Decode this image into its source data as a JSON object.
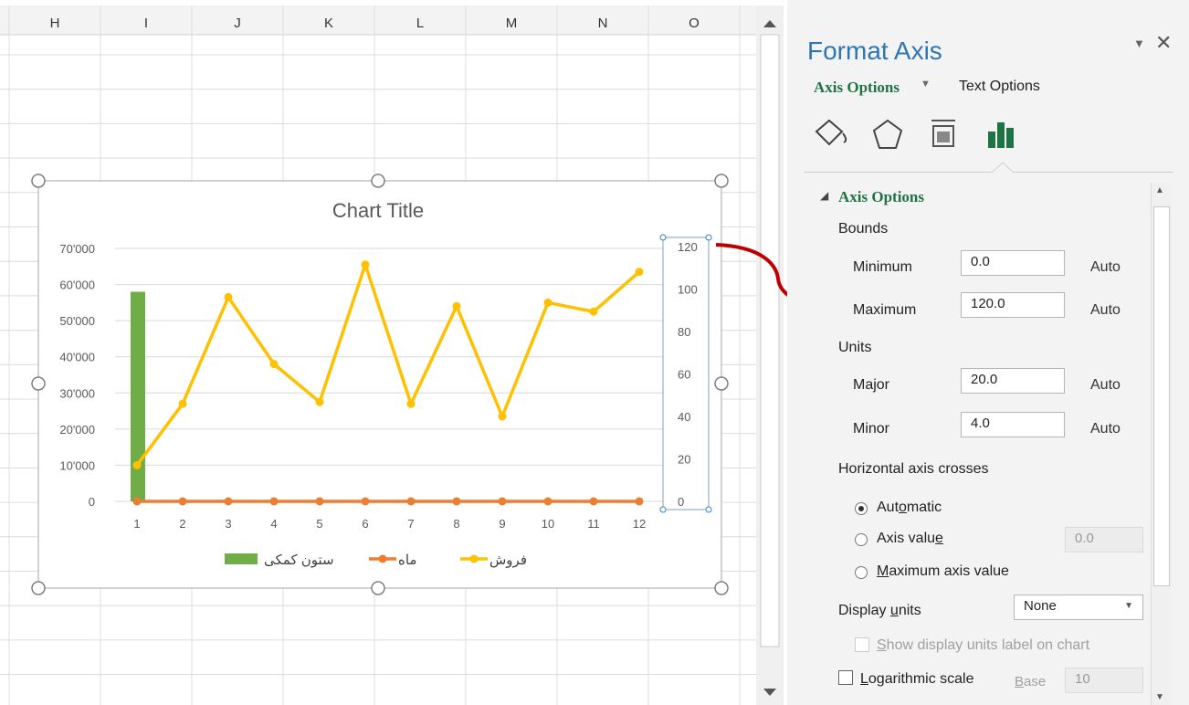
{
  "sheet": {
    "columns": [
      "H",
      "I",
      "J",
      "K",
      "L",
      "M",
      "N",
      "O"
    ]
  },
  "chart": {
    "title": "Chart Title"
  },
  "chart_data": {
    "type": "line",
    "title": "Chart Title",
    "x": [
      1,
      2,
      3,
      4,
      5,
      6,
      7,
      8,
      9,
      10,
      11,
      12
    ],
    "y_axis_left": {
      "ticks": [
        "0",
        "10'000",
        "20'000",
        "30'000",
        "40'000",
        "50'000",
        "60'000",
        "70'000"
      ],
      "range": [
        0,
        70000
      ]
    },
    "y_axis_right": {
      "ticks": [
        "0",
        "20",
        "40",
        "60",
        "80",
        "100",
        "120"
      ],
      "range": [
        0,
        120
      ]
    },
    "series": [
      {
        "name": "ستون کمکی",
        "type": "bar",
        "axis": "left",
        "color": "#70ad47",
        "values": [
          58000,
          0,
          0,
          0,
          0,
          0,
          0,
          0,
          0,
          0,
          0,
          0
        ]
      },
      {
        "name": "ماه",
        "type": "line",
        "axis": "left",
        "color": "#ed7d31",
        "values": [
          0,
          0,
          0,
          0,
          0,
          0,
          0,
          0,
          0,
          0,
          0,
          0
        ]
      },
      {
        "name": "فروش",
        "type": "line",
        "axis": "left",
        "color": "#ffc000",
        "values": [
          10000,
          27000,
          56500,
          38000,
          27500,
          65500,
          27000,
          54000,
          23500,
          55000,
          52500,
          63500
        ]
      }
    ],
    "legend": [
      "ستون کمکی",
      "ماه",
      "فروش"
    ],
    "legend_position": "bottom"
  },
  "panel": {
    "title": "Format Axis",
    "tab_axis_options": "Axis Options",
    "tab_text_options": "Text Options",
    "section_title": "Axis Options",
    "bounds_label": "Bounds",
    "minimum_label": "Minimum",
    "minimum_value": "0.0",
    "maximum_label": "Maximum",
    "maximum_value": "120.0",
    "units_label": "Units",
    "major_label": "Major",
    "major_value": "20.0",
    "minor_label": "Minor",
    "minor_value": "4.0",
    "auto_label": "Auto",
    "hcross_label": "Horizontal axis crosses",
    "radio_automatic_a": "Aut",
    "radio_automatic_u": "o",
    "radio_automatic_b": "matic",
    "radio_axis_value_a": "Axis valu",
    "radio_axis_value_u": "e",
    "axis_value_field": "0.0",
    "radio_max_u": "M",
    "radio_max_b": "aximum axis value",
    "display_units_a": "Display ",
    "display_units_u": "u",
    "display_units_b": "nits",
    "display_units_value": "None",
    "show_units_u": "S",
    "show_units_b": "how display units label on chart",
    "log_u": "L",
    "log_b": "ogarithmic scale",
    "base_u": "B",
    "base_b": "ase",
    "base_value": "10",
    "colors": {
      "accent": "#217346",
      "title": "#2e75b6"
    }
  }
}
